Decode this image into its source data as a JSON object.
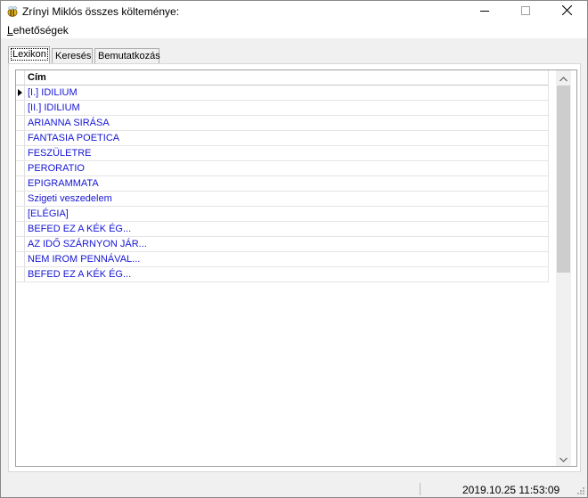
{
  "window": {
    "title": "Zrínyi Miklós összes költeménye:",
    "app_icon": "bee-icon",
    "controls": {
      "minimize": "minimize-icon",
      "maximize": "maximize-icon",
      "close": "close-icon"
    }
  },
  "menubar": {
    "items": [
      {
        "accel": "L",
        "rest": "ehetőségek"
      }
    ]
  },
  "tabs": [
    {
      "label": "Lexikon",
      "active": true
    },
    {
      "label": "Keresés",
      "active": false
    },
    {
      "label": "Bemutatkozás",
      "active": false
    }
  ],
  "grid": {
    "column": "Cím",
    "rows": [
      "[I.] IDILIUM",
      "[II.] IDILIUM",
      "ARIANNA SIRÁSA",
      "FANTASIA POETICA",
      "FESZÜLETRE",
      "PERORATIO",
      "EPIGRAMMATA",
      "Szigeti veszedelem",
      "[ELÉGIA]",
      "BEFED EZ A KÉK ÉG...",
      "AZ IDŐ SZÁRNYON JÁR...",
      "NEM IROM PENNÁVAL...",
      "BEFED EZ A KÉK ÉG..."
    ],
    "current_row": 0,
    "link_color": "#1515d5"
  },
  "status": {
    "datetime": "2019.10.25 11:53:09"
  }
}
